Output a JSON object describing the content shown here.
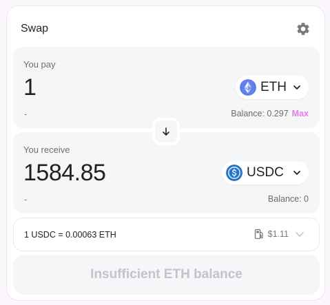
{
  "header": {
    "title": "Swap",
    "settings_icon": "gear-icon"
  },
  "pay": {
    "label": "You pay",
    "amount": "1",
    "fiat": "-",
    "token_symbol": "ETH",
    "token_icon": "ethereum-icon",
    "balance_text": "Balance: 0.297",
    "max_label": "Max"
  },
  "receive": {
    "label": "You receive",
    "amount": "1584.85",
    "fiat": "-",
    "token_symbol": "USDC",
    "token_icon": "usdc-icon",
    "balance_text": "Balance: 0"
  },
  "rate": {
    "text": "1 USDC = 0.00063 ETH",
    "gas_icon": "gas-pump-icon",
    "gas_fee": "$1.11"
  },
  "cta": {
    "label": "Insufficient ETH balance"
  },
  "colors": {
    "accent_pink": "#e87be8",
    "eth_blue": "#627eea",
    "usdc_blue": "#2775ca",
    "panel_bg": "#f5f6f8",
    "disabled_text": "#c2c4cc"
  }
}
